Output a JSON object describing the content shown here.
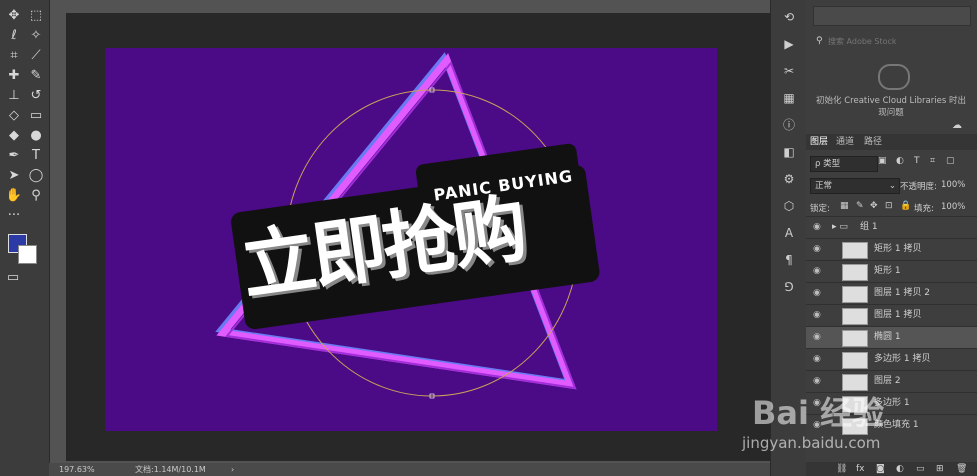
{
  "toolbar": {
    "tools": [
      {
        "icon": "move-tool-icon",
        "glyph": "✥"
      },
      {
        "icon": "marquee-tool-icon",
        "glyph": "⬚"
      },
      {
        "icon": "lasso-tool-icon",
        "glyph": "ℓ"
      },
      {
        "icon": "magic-wand-icon",
        "glyph": "✧"
      },
      {
        "icon": "crop-tool-icon",
        "glyph": "⌗"
      },
      {
        "icon": "eyedropper-icon",
        "glyph": "⟋"
      },
      {
        "icon": "healing-brush-icon",
        "glyph": "✚"
      },
      {
        "icon": "brush-tool-icon",
        "glyph": "✎"
      },
      {
        "icon": "stamp-tool-icon",
        "glyph": "⊥"
      },
      {
        "icon": "history-brush-icon",
        "glyph": "↺"
      },
      {
        "icon": "eraser-icon",
        "glyph": "◇"
      },
      {
        "icon": "gradient-tool-icon",
        "glyph": "▭"
      },
      {
        "icon": "blur-tool-icon",
        "glyph": "◆"
      },
      {
        "icon": "dodge-tool-icon",
        "glyph": "●"
      },
      {
        "icon": "pen-tool-icon",
        "glyph": "✒"
      },
      {
        "icon": "type-tool-icon",
        "glyph": "T"
      },
      {
        "icon": "path-select-icon",
        "glyph": "➤"
      },
      {
        "icon": "ellipse-tool-icon",
        "glyph": "◯"
      },
      {
        "icon": "hand-tool-icon",
        "glyph": "✋"
      },
      {
        "icon": "zoom-tool-icon",
        "glyph": "⚲"
      },
      {
        "icon": "more-tools-icon",
        "glyph": "···"
      }
    ],
    "foreground_color": "#2c3aa6",
    "background_color": "#ffffff"
  },
  "artwork": {
    "background": "#4b0a86",
    "title_cn": "立即抢购",
    "title_en": "PANIC BUYING"
  },
  "statusbar": {
    "zoom": "197.63%",
    "doc_info": "文档:1.14M/10.1M"
  },
  "right_strip": {
    "icons": [
      "history-icon",
      "play-icon",
      "tools-preset-icon",
      "grid-icon",
      "info-icon",
      "layers-icon",
      "adjust-icon",
      "cube-icon",
      "character-icon",
      "paragraph-icon",
      "glyph-icon"
    ]
  },
  "libraries": {
    "search_placeholder": "搜索 Adobe Stock",
    "message": "初始化 Creative Cloud Libraries 时出现问题"
  },
  "layers_panel": {
    "tabs": [
      "图层",
      "通道",
      "路径"
    ],
    "filter_label": "ρ 类型",
    "blend_mode": "正常",
    "opacity_label": "不透明度:",
    "opacity_value": "100%",
    "lock_label": "锁定:",
    "fill_label": "填充:",
    "fill_value": "100%",
    "layers": [
      {
        "name": "组 1",
        "type": "group"
      },
      {
        "name": "矩形 1 拷贝",
        "type": "shape"
      },
      {
        "name": "矩形 1",
        "type": "shape"
      },
      {
        "name": "图层 1 拷贝 2",
        "type": "pixel"
      },
      {
        "name": "图层 1 拷贝",
        "type": "pixel"
      },
      {
        "name": "椭圆 1",
        "type": "shape",
        "selected": true
      },
      {
        "name": "多边形 1 拷贝",
        "type": "shape"
      },
      {
        "name": "图层 2",
        "type": "pixel"
      },
      {
        "name": "多边形 1",
        "type": "shape"
      },
      {
        "name": "颜色填充 1",
        "type": "fill"
      }
    ],
    "footer_icons": [
      "link-icon",
      "fx-icon",
      "mask-icon",
      "adjustment-icon",
      "folder-icon",
      "new-layer-icon",
      "trash-icon"
    ]
  },
  "watermark": {
    "brand": "Bai 经验",
    "url": "jingyan.baidu.com"
  }
}
